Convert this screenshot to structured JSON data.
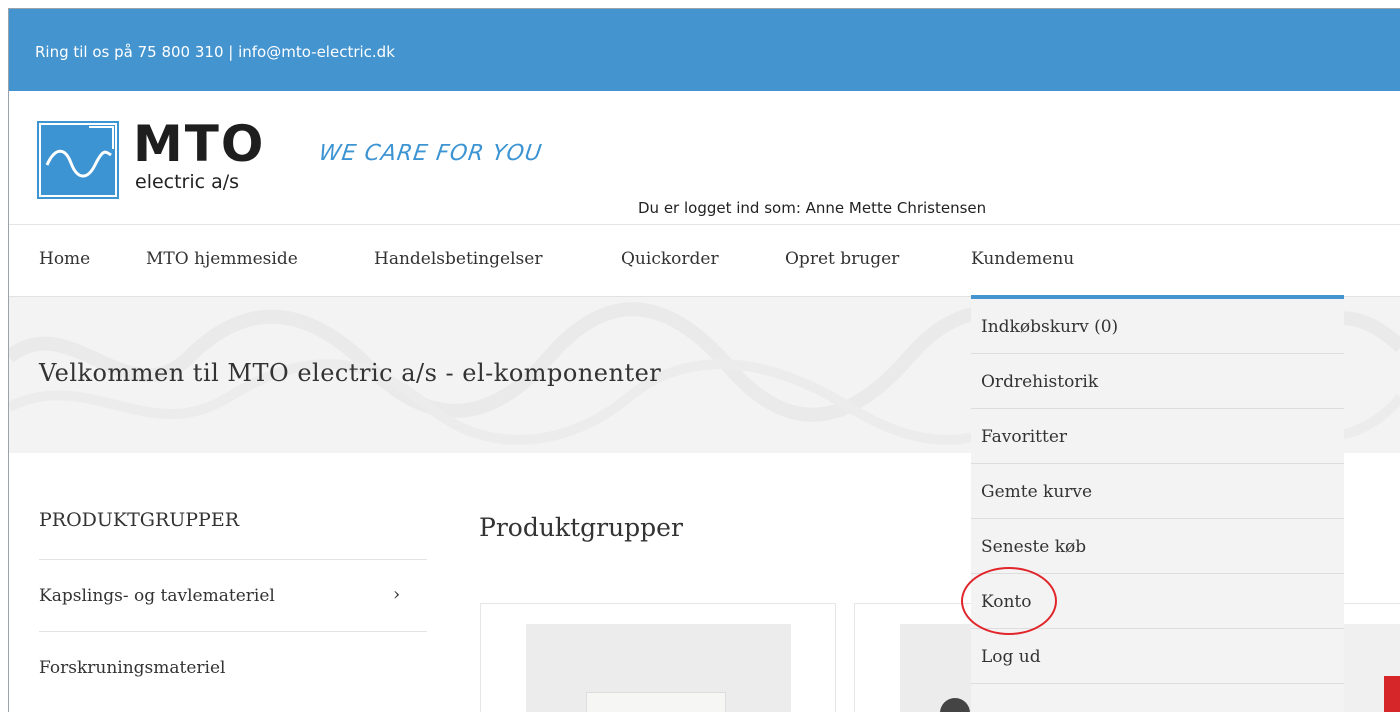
{
  "topbar": {
    "contact": "Ring til os på 75 800 310  |  info@mto-electric.dk"
  },
  "logo": {
    "brand": "MTO",
    "sub": "electric a/s",
    "tagline": "WE CARE FOR YOU"
  },
  "header": {
    "logged_in": "Du er logget ind som: Anne Mette Christensen"
  },
  "nav": {
    "items": [
      {
        "label": "Home"
      },
      {
        "label": "MTO hjemmeside"
      },
      {
        "label": "Handelsbetingelser"
      },
      {
        "label": "Quickorder"
      },
      {
        "label": "Opret bruger"
      },
      {
        "label": "Kundemenu"
      }
    ]
  },
  "dropdown": {
    "items": [
      {
        "label": "Indkøbskurv (0)"
      },
      {
        "label": "Ordrehistorik"
      },
      {
        "label": "Favoritter"
      },
      {
        "label": "Gemte kurve"
      },
      {
        "label": "Seneste køb"
      },
      {
        "label": "Konto"
      },
      {
        "label": "Log ud"
      }
    ]
  },
  "hero": {
    "title": "Velkommen til MTO electric a/s - el-komponenter"
  },
  "sidebar": {
    "heading": "PRODUKTGRUPPER",
    "categories": [
      {
        "label": "Kapslings- og tavlemateriel",
        "chevron": "›"
      },
      {
        "label": "Forskruningsmateriel"
      }
    ]
  },
  "main": {
    "title": "Produktgrupper"
  },
  "colors": {
    "brand_blue": "#4494d0",
    "annotation_red": "#e0262b"
  }
}
